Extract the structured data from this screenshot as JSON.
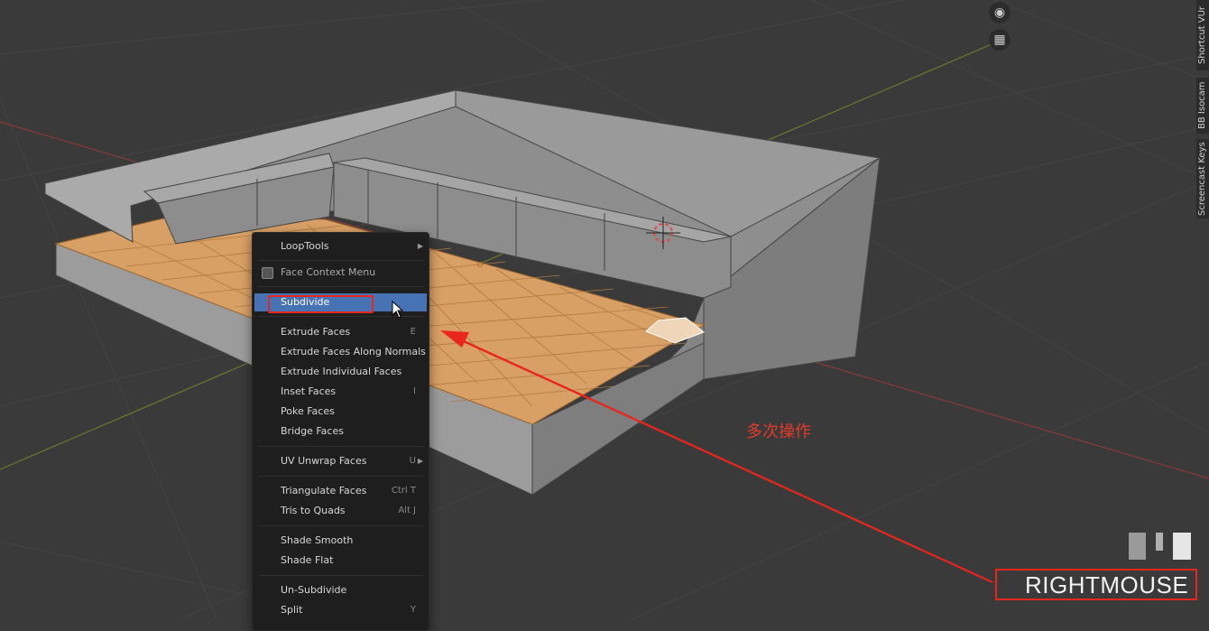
{
  "menu": {
    "items": [
      {
        "label": "LoopTools",
        "shortcut": "",
        "submenu": true
      },
      {
        "label": "Face Context Menu",
        "shortcut": "",
        "submenu": false
      },
      {
        "label": "Subdivide",
        "shortcut": "",
        "submenu": false
      },
      {
        "label": "Extrude Faces",
        "shortcut": "E",
        "submenu": false
      },
      {
        "label": "Extrude Faces Along Normals",
        "shortcut": "",
        "submenu": false
      },
      {
        "label": "Extrude Individual Faces",
        "shortcut": "",
        "submenu": false
      },
      {
        "label": "Inset Faces",
        "shortcut": "I",
        "submenu": false
      },
      {
        "label": "Poke Faces",
        "shortcut": "",
        "submenu": false
      },
      {
        "label": "Bridge Faces",
        "shortcut": "",
        "submenu": false
      },
      {
        "label": "UV Unwrap Faces",
        "shortcut": "U",
        "submenu": true
      },
      {
        "label": "Triangulate Faces",
        "shortcut": "Ctrl T",
        "submenu": false
      },
      {
        "label": "Tris to Quads",
        "shortcut": "Alt J",
        "submenu": false
      },
      {
        "label": "Shade Smooth",
        "shortcut": "",
        "submenu": false
      },
      {
        "label": "Shade Flat",
        "shortcut": "",
        "submenu": false
      },
      {
        "label": "Un-Subdivide",
        "shortcut": "",
        "submenu": false
      },
      {
        "label": "Split",
        "shortcut": "Y",
        "submenu": false
      }
    ],
    "active_index": 2
  },
  "side_tabs": [
    "Shortcut VUr",
    "BB Isocam",
    "Screencast Keys"
  ],
  "annotation": {
    "note": "多次操作",
    "color": "#e43a2a"
  },
  "key_display": {
    "text": "RIGHTMOUSE"
  },
  "icons": {
    "camera": "camera-icon",
    "grid": "grid-view-icon"
  },
  "colors": {
    "background": "#3a3a3a",
    "menu_bg": "#1e1e1e",
    "highlight": "#4772b3",
    "selected_face": "#d9a066",
    "mesh": "#9a9a9a",
    "annotation": "#e8261c"
  }
}
